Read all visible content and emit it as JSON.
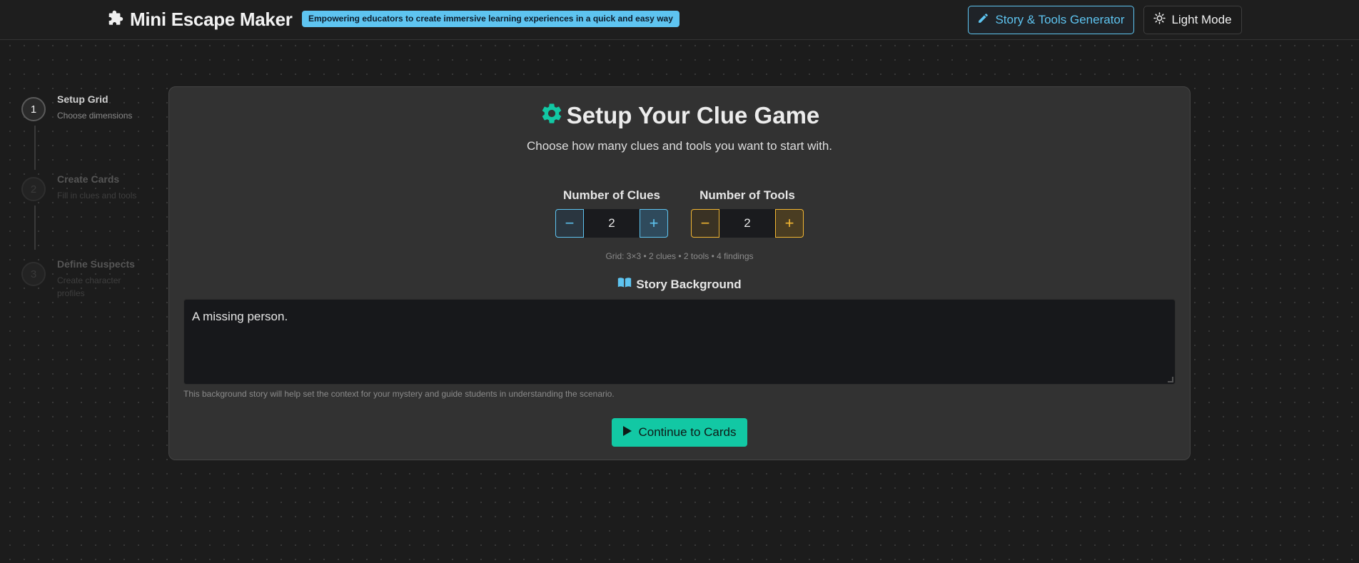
{
  "header": {
    "app_title": "Mini Escape Maker",
    "tagline": "Empowering educators to create immersive learning experiences in a quick and easy way",
    "story_button": "Story & Tools Generator",
    "theme_button": "Light Mode",
    "brand_icon": "puzzle-icon"
  },
  "steps": [
    {
      "number": "1",
      "title": "Setup Grid",
      "subtitle": "Choose dimensions",
      "active": true
    },
    {
      "number": "2",
      "title": "Create Cards",
      "subtitle": "Fill in clues and tools",
      "active": false
    },
    {
      "number": "3",
      "title": "Define Suspects",
      "subtitle_line1": "Create character",
      "subtitle_line2": "profiles",
      "active": false
    }
  ],
  "setup": {
    "title": "Setup Your Clue Game",
    "subtitle": "Choose how many clues and tools you want to start with.",
    "clues": {
      "label": "Number of Clues",
      "value": "2",
      "minus": "−",
      "plus": "+"
    },
    "tools": {
      "label": "Number of Tools",
      "value": "2",
      "minus": "−",
      "plus": "+"
    },
    "grid_info": "Grid: 3×3 • 2 clues • 2 tools • 4 findings",
    "story_label": "Story Background",
    "story_text": "A missing person.",
    "story_hint": "This background story will help set the context for your mystery and guide students in understanding the scenario.",
    "continue_button": "Continue to Cards"
  },
  "colors": {
    "accent_teal": "#12c8a4",
    "accent_blue": "#5ec4f0",
    "accent_gold": "#f2b632",
    "background": "#1c1c1c",
    "card": "#323232"
  }
}
